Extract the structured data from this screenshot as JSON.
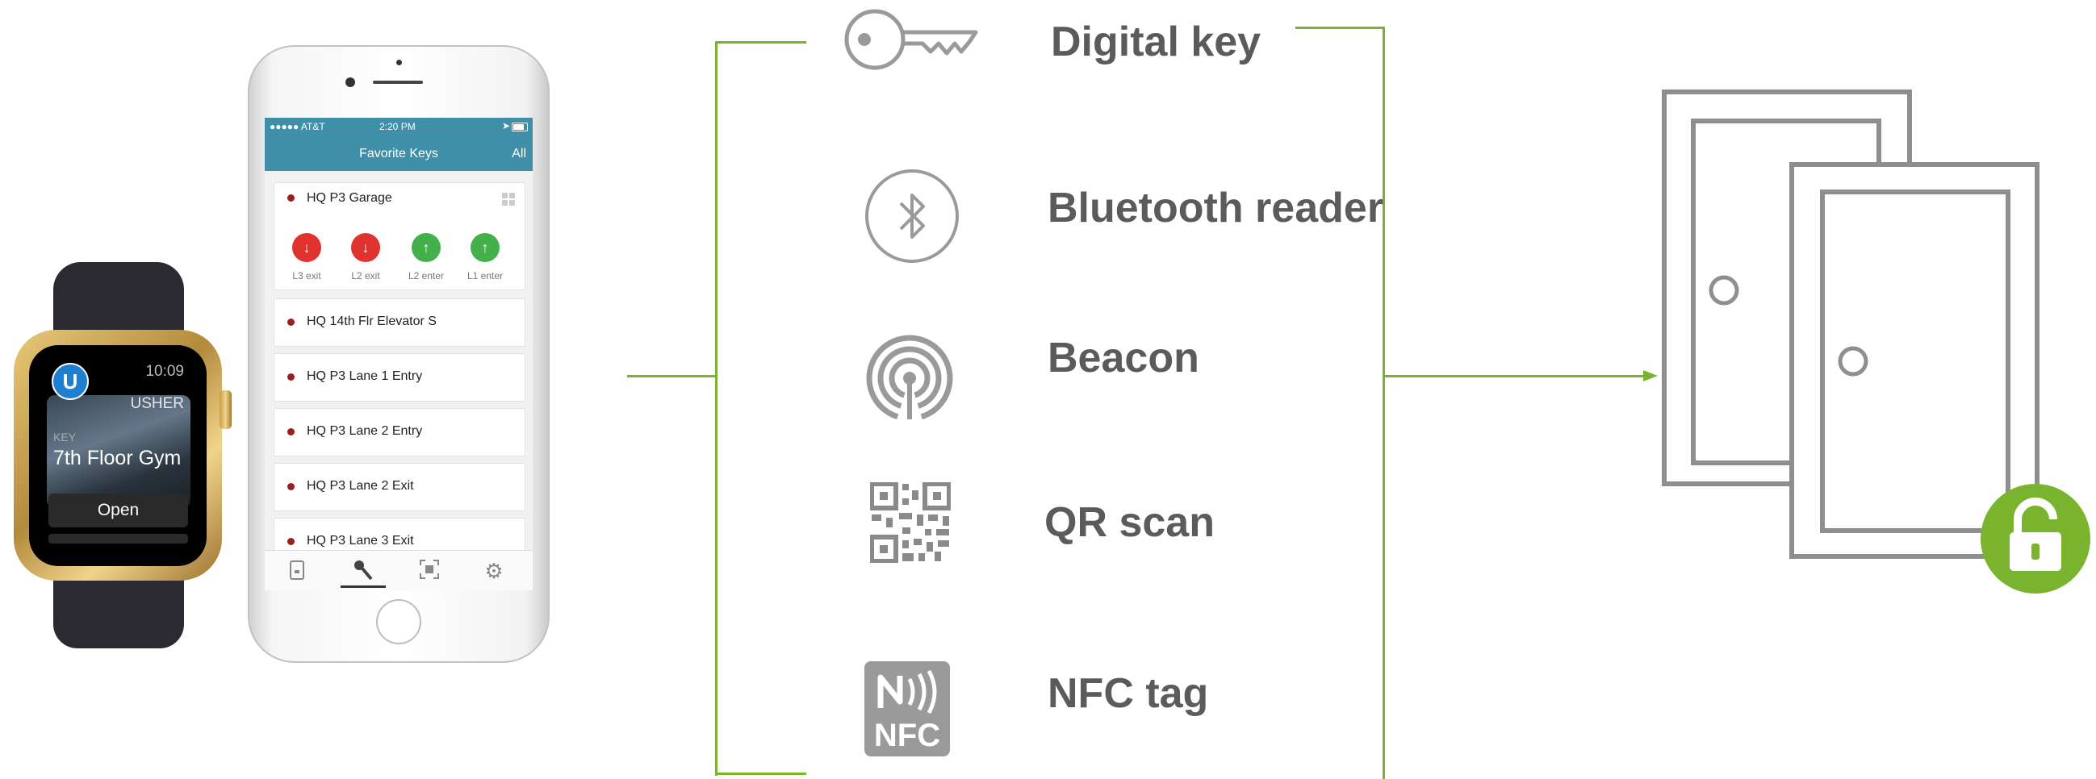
{
  "watch": {
    "time": "10:09",
    "app_name": "USHER",
    "logo_letter": "U",
    "key_caption": "KEY",
    "key_name": "7th Floor Gym",
    "open_label": "Open"
  },
  "phone": {
    "status": {
      "carrier": "●●●●● AT&T",
      "time": "2:20 PM"
    },
    "nav": {
      "title": "Favorite Keys",
      "right": "All"
    },
    "first_card": {
      "label": "HQ P3 Garage",
      "buttons": [
        {
          "caption": "L3 exit",
          "direction": "down",
          "color": "#e0332e"
        },
        {
          "caption": "L2 exit",
          "direction": "down",
          "color": "#e0332e"
        },
        {
          "caption": "L2 enter",
          "direction": "up",
          "color": "#44b04a"
        },
        {
          "caption": "L1 enter",
          "direction": "up",
          "color": "#44b04a"
        }
      ]
    },
    "keys": [
      "HQ 14th Flr Elevator S",
      "HQ P3 Lane 1 Entry",
      "HQ P3 Lane 2 Entry",
      "HQ P3 Lane 2 Exit",
      "HQ P3 Lane 3 Exit"
    ],
    "tabs": [
      "badge-icon",
      "key-icon",
      "scan-icon",
      "gear-icon"
    ]
  },
  "options": [
    {
      "label": "Digital key",
      "icon": "key-icon"
    },
    {
      "label": "Bluetooth reader",
      "icon": "bluetooth-icon"
    },
    {
      "label": "Beacon",
      "icon": "beacon-icon"
    },
    {
      "label": "QR scan",
      "icon": "qr-code-icon"
    },
    {
      "label": "NFC tag",
      "icon": "nfc-tag-icon",
      "icon_text": "NFC"
    }
  ],
  "colors": {
    "accent": "#7ab32e",
    "text": "#5b5b5b",
    "icon": "#9a9a9a",
    "lock": "#7ab32e"
  },
  "target": {
    "icon": "doors-icon",
    "badge": "unlocked-padlock-icon"
  }
}
